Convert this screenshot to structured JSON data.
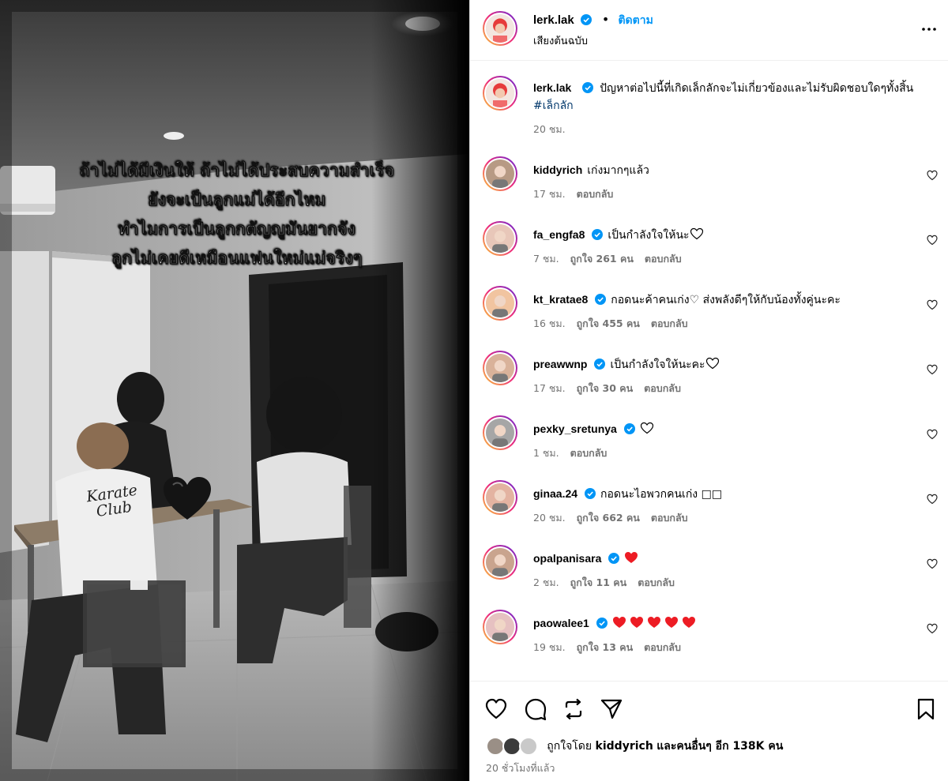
{
  "media": {
    "overlay_lines": [
      "ถ้าไม่ได้มีเงินให้ ถ้าไม่ได้ประสบความสำเร็จ",
      "ยังจะเป็นลูกแม่ได้อีกไหม",
      "ทำไมการเป็นลูกกตัญญูมันยากจัง",
      "ลูกไม่เคยดีเหมือนแฟนใหม่แม่จริงๆ"
    ],
    "shirt_text": "Karate Club"
  },
  "header": {
    "username": "lerk.lak",
    "follow_label": "ติดตาม",
    "subtitle": "เสียงต้นฉบับ"
  },
  "caption": {
    "username": "lerk.lak",
    "text": "ปัญหาต่อไปนี้ที่เกิดเล็กลักจะไม่เกี่ยวข้องและไม่รับผิดชอบใดๆทั้งสิ้น",
    "hashtag": "#เล็กลัก",
    "time": "20 ชม."
  },
  "comments": [
    {
      "username": "kiddyrich",
      "verified": false,
      "text": "เก่งมากๆแล้ว",
      "hearts": 0,
      "outline_heart": false,
      "time": "17 ชม.",
      "likes": "",
      "reply": "ตอบกลับ"
    },
    {
      "username": "fa_engfa8",
      "verified": true,
      "text": "เป็นกำลังใจให้นะ",
      "hearts": 0,
      "outline_heart": true,
      "time": "7 ชม.",
      "likes": "ถูกใจ 261 คน",
      "reply": "ตอบกลับ"
    },
    {
      "username": "kt_kratae8",
      "verified": true,
      "text": "กอดนะค้าคนเก่ง♡ ส่งพลังดีๆให้กับน้องทั้งคู่นะคะ",
      "hearts": 0,
      "outline_heart": false,
      "time": "16 ชม.",
      "likes": "ถูกใจ 455 คน",
      "reply": "ตอบกลับ"
    },
    {
      "username": "preawwnp",
      "verified": true,
      "text": "เป็นกำลังใจให้นะคะ",
      "hearts": 0,
      "outline_heart": true,
      "time": "17 ชม.",
      "likes": "ถูกใจ 30 คน",
      "reply": "ตอบกลับ"
    },
    {
      "username": "pexky_sretunya",
      "verified": true,
      "text": "",
      "hearts": 0,
      "outline_heart": true,
      "time": "1 ชม.",
      "likes": "",
      "reply": "ตอบกลับ"
    },
    {
      "username": "ginaa.24",
      "verified": true,
      "text": "กอดนะไอพวกคนเก่ง □□",
      "hearts": 0,
      "outline_heart": false,
      "time": "20 ชม.",
      "likes": "ถูกใจ 662 คน",
      "reply": "ตอบกลับ"
    },
    {
      "username": "opalpanisara",
      "verified": true,
      "text": "",
      "hearts": 1,
      "outline_heart": false,
      "time": "2 ชม.",
      "likes": "ถูกใจ 11 คน",
      "reply": "ตอบกลับ"
    },
    {
      "username": "paowalee1",
      "verified": true,
      "text": "",
      "hearts": 5,
      "outline_heart": false,
      "time": "19 ชม.",
      "likes": "ถูกใจ 13 คน",
      "reply": "ตอบกลับ"
    }
  ],
  "likes": {
    "prefix": "ถูกใจโดย",
    "user": "kiddyrich",
    "and_others": "และคนอื่นๆ อีก 138K คน"
  },
  "time_ago": "20 ชั่วโมงที่แล้ว",
  "colors": {
    "accent": "#0095f6",
    "muted": "#737373",
    "heart_red": "#ed1c24",
    "verified": "#0095f6"
  },
  "icons": [
    "more-options-icon",
    "like-icon",
    "comment-icon",
    "repost-icon",
    "share-icon",
    "save-icon",
    "verified-badge-icon"
  ]
}
